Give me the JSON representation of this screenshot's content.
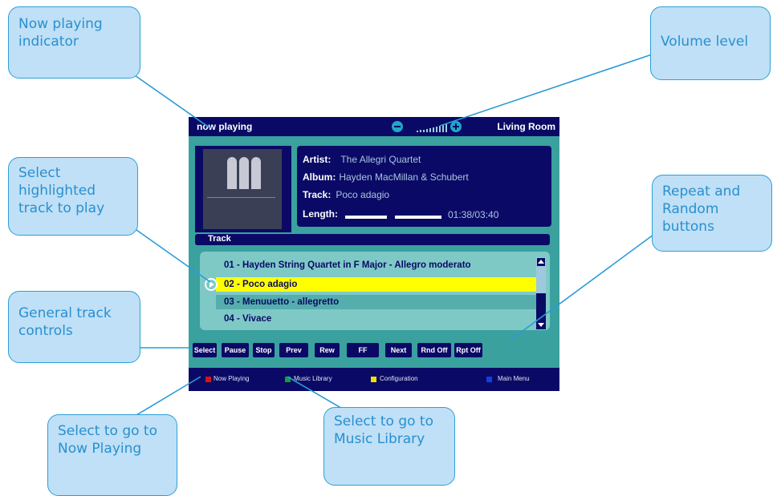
{
  "callouts": {
    "now_playing_indicator": "Now playing indicator",
    "volume_level": "Volume level",
    "select_highlighted": "Select highlighted track to play",
    "repeat_random": "Repeat and Random buttons",
    "general_controls": "General track controls",
    "go_now_playing": "Select to go to Now Playing",
    "go_music_library": "Select to go to Music Library"
  },
  "screen": {
    "header": {
      "title": "now playing",
      "room": "Living Room"
    },
    "info": {
      "artist_label": "Artist:",
      "artist": "The Allegri Quartet",
      "album_label": "Album:",
      "album": "Hayden MacMillan & Schubert",
      "track_label": "Track:",
      "track": "Poco adagio",
      "length_label": "Length:",
      "length": "01:38/03:40",
      "progress": 0.43
    },
    "track_header": "Track",
    "tracks": [
      "01 - Hayden String Quartet in F Major - Allegro moderato",
      "02 - Poco adagio",
      "03 - Menuuetto - allegretto",
      "04 - Vivace"
    ],
    "selected_track_index": 1,
    "controls": [
      "Select",
      "Pause",
      "Stop",
      "Prev",
      "Rew",
      "FF",
      "Next",
      "Rnd Off",
      "Rpt Off"
    ],
    "bottom_nav": [
      {
        "label": "Now Playing",
        "color": "#e01010"
      },
      {
        "label": "Music Library",
        "color": "#10a030"
      },
      {
        "label": "Configuration",
        "color": "#f0e000"
      },
      {
        "label": "Main Menu",
        "color": "#1040e0"
      }
    ]
  }
}
